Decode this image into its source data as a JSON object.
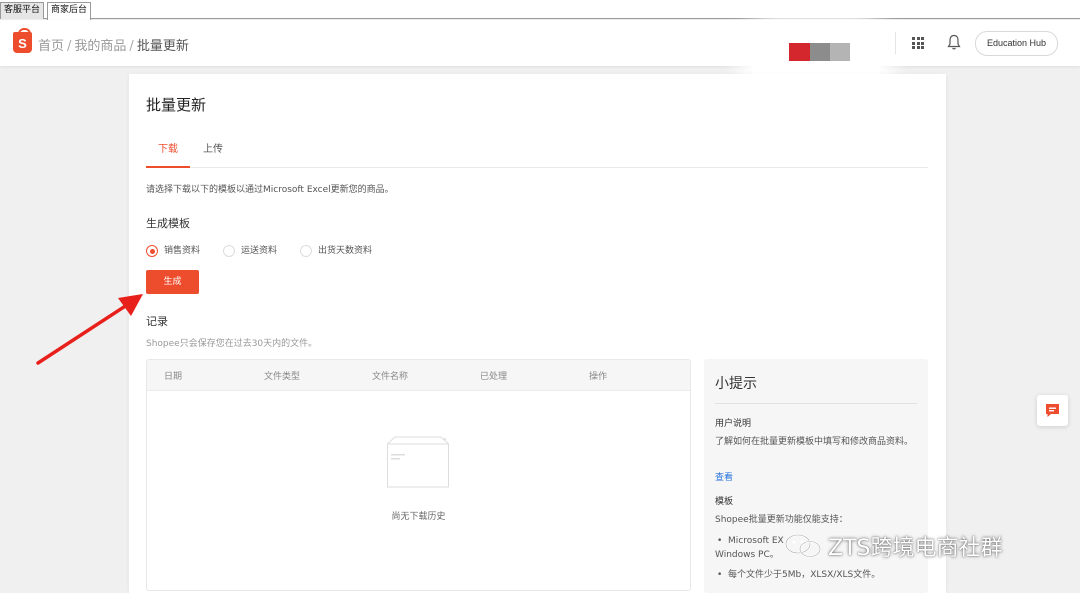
{
  "browser_tabs": [
    {
      "label": "客服平台",
      "active": false
    },
    {
      "label": "商家后台",
      "active": true
    }
  ],
  "header": {
    "logo_letter": "S",
    "breadcrumb": [
      "首页",
      "我的商品",
      "批量更新"
    ],
    "breadcrumb_sep": "/",
    "hub_button": "Education Hub",
    "icons": [
      "apps-grid-icon",
      "bell-icon"
    ]
  },
  "page": {
    "title": "批量更新",
    "tabs": [
      {
        "label": "下载",
        "active": true
      },
      {
        "label": "上传",
        "active": false
      }
    ],
    "intro": "请选择下载以下的模板以通过Microsoft Excel更新您的商品。",
    "template_section": {
      "title": "生成模板",
      "options": [
        {
          "label": "销售资料",
          "checked": true
        },
        {
          "label": "运送资料",
          "checked": false
        },
        {
          "label": "出货天数资料",
          "checked": false
        }
      ],
      "generate_button": "生成"
    },
    "records": {
      "title": "记录",
      "subtitle": "Shopee只会保存您在过去30天内的文件。",
      "columns": [
        "日期",
        "文件类型",
        "文件名称",
        "已处理",
        "操作"
      ],
      "empty_text": "尚无下载历史"
    },
    "tips": {
      "title": "小提示",
      "user_guide_title": "用户说明",
      "user_guide_text": "了解如何在批量更新模板中填写和修改商品资料。",
      "view_link": "查看",
      "template_title": "模板",
      "template_text": "Shopee批量更新功能仅能支持：",
      "bullets": [
        "Microsoft EX",
        "Windows PC。",
        "每个文件少于5Mb，XLSX/XLS文件。"
      ],
      "bullet_mark": "•"
    }
  },
  "watermark": "ZTS跨境电商社群",
  "colors": {
    "brand": "#ee4d2d",
    "link": "#2673dd",
    "blur_red": "#d3262d",
    "arrow_red": "#e8201c"
  }
}
